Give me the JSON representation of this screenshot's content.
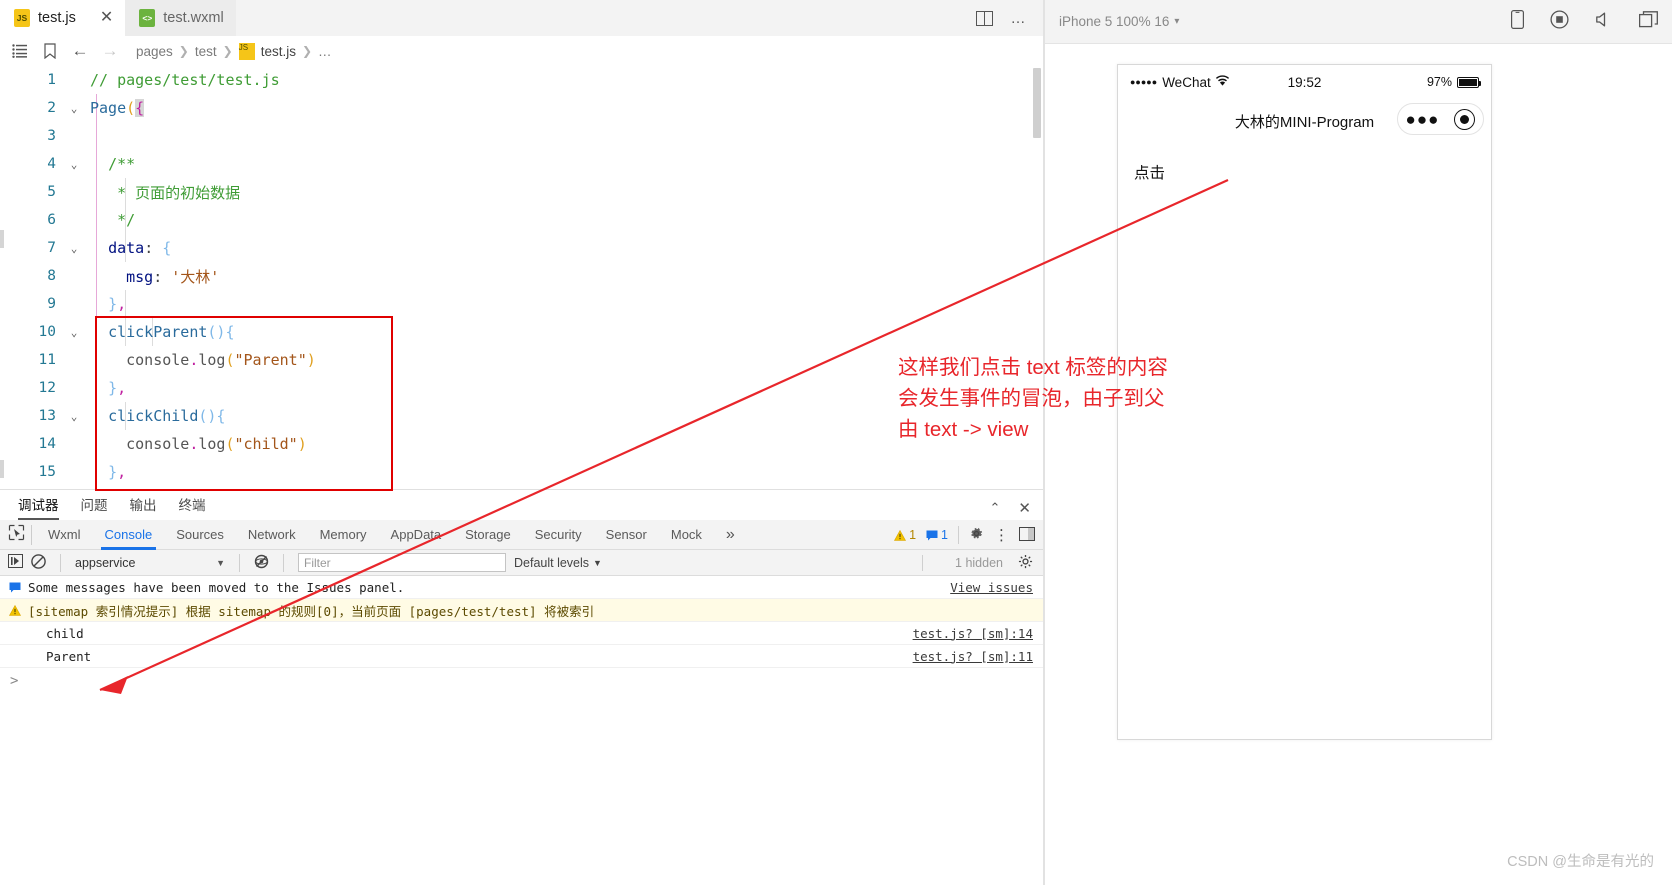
{
  "editor": {
    "tabs": [
      {
        "label": "test.js",
        "icon": "js-file-icon",
        "icon_text": "JS",
        "active": true,
        "closable": true
      },
      {
        "label": "test.wxml",
        "icon": "wxml-file-icon",
        "icon_text": "<>",
        "active": false,
        "closable": false
      }
    ],
    "tabbar_actions": [
      {
        "name": "split-editor-icon",
        "glyph": "▯▯"
      },
      {
        "name": "more-actions-icon",
        "glyph": "…"
      }
    ],
    "breadcrumb": {
      "icons": [
        {
          "name": "outline-icon",
          "glyph": "☰"
        },
        {
          "name": "bookmark-icon",
          "glyph": "🔖"
        },
        {
          "name": "back-arrow-icon",
          "glyph": "←"
        },
        {
          "name": "forward-arrow-icon",
          "glyph": "→"
        }
      ],
      "parts": [
        "pages",
        "test",
        "test.js",
        "…"
      ]
    },
    "lines": [
      {
        "num": "1",
        "fold": "",
        "html": "<span class='cmt'>// pages/test/test.js</span>"
      },
      {
        "num": "2",
        "fold": "⌄",
        "html": "<span class='fn'>Page</span><span class='paren'>(</span><span class='brace-p selbrace'>{</span>"
      },
      {
        "num": "3",
        "fold": "",
        "html": ""
      },
      {
        "num": "4",
        "fold": "⌄",
        "html": "  <span class='cmt'>/**</span>"
      },
      {
        "num": "5",
        "fold": "",
        "html": "   <span class='cmt'>* 页面的初始数据</span>"
      },
      {
        "num": "6",
        "fold": "",
        "html": "   <span class='cmt'>*/</span>"
      },
      {
        "num": "7",
        "fold": "⌄",
        "html": "  <span class='prop'>data</span><span class='punct'>:</span> <span class='brace-b'>{</span>"
      },
      {
        "num": "8",
        "fold": "",
        "html": "    <span class='prop'>msg</span><span class='punct'>:</span> <span class='str'>'大林'</span>"
      },
      {
        "num": "9",
        "fold": "",
        "html": "  <span class='brace-b'>}</span><span class='brace-p'>,</span>"
      },
      {
        "num": "10",
        "fold": "⌄",
        "html": "  <span class='fn'>clickParent</span><span class='brace-b'>(){</span>"
      },
      {
        "num": "11",
        "fold": "",
        "html": "    <span class='obj'>console</span><span class='dot'>.</span><span class='obj'>log</span><span class='paren'>(</span><span class='str'>\"Parent\"</span><span class='paren'>)</span>"
      },
      {
        "num": "12",
        "fold": "",
        "html": "  <span class='brace-b'>}</span><span class='brace-p'>,</span>"
      },
      {
        "num": "13",
        "fold": "⌄",
        "html": "  <span class='fn'>clickChild</span><span class='brace-b'>(){</span>"
      },
      {
        "num": "14",
        "fold": "",
        "html": "    <span class='obj'>console</span><span class='dot'>.</span><span class='obj'>log</span><span class='paren'>(</span><span class='str'>\"child\"</span><span class='paren'>)</span>"
      },
      {
        "num": "15",
        "fold": "",
        "html": "  <span class='brace-b'>}</span><span class='brace-p'>,</span>"
      }
    ]
  },
  "devtools": {
    "panel_tabs": [
      {
        "label": "调试器",
        "active": true
      },
      {
        "label": "问题",
        "active": false
      },
      {
        "label": "输出",
        "active": false
      },
      {
        "label": "终端",
        "active": false
      }
    ],
    "panel_actions": [
      {
        "name": "collapse-panel-icon",
        "glyph": "⌃"
      },
      {
        "name": "close-panel-icon",
        "glyph": "✕"
      }
    ],
    "inspect_icon": "inspect-element-icon",
    "tabs": [
      {
        "label": "Wxml",
        "active": false
      },
      {
        "label": "Console",
        "active": true
      },
      {
        "label": "Sources",
        "active": false
      },
      {
        "label": "Network",
        "active": false
      },
      {
        "label": "Memory",
        "active": false
      },
      {
        "label": "AppData",
        "active": false
      },
      {
        "label": "Storage",
        "active": false
      },
      {
        "label": "Security",
        "active": false
      },
      {
        "label": "Sensor",
        "active": false
      },
      {
        "label": "Mock",
        "active": false
      }
    ],
    "overflow_glyph": "»",
    "warning_count": "1",
    "message_count": "1",
    "settings_icon": "gear-icon",
    "more_icon": "vertical-dots-icon",
    "dock_icon": "dock-panel-icon",
    "filterbar": {
      "execute_icon": "execute-step-icon",
      "clear_icon": "clear-console-icon",
      "context": "appservice",
      "context_caret": "▼",
      "eye_icon": "hide-network-icon",
      "filter_value": "",
      "filter_placeholder": "Filter",
      "levels_label": "Default levels",
      "levels_caret": "▼",
      "hidden_label": "1 hidden",
      "settings_icon": "console-settings-icon"
    },
    "messages": [
      {
        "type": "info",
        "icon": "message-icon",
        "text": "Some messages have been moved to the Issues panel.",
        "link": "View issues"
      },
      {
        "type": "warn",
        "icon": "warning-icon",
        "text": "[sitemap 索引情况提示] 根据 sitemap 的规则[0]，当前页面 [pages/test/test] 将被索引",
        "link": ""
      },
      {
        "type": "log",
        "icon": "",
        "text": "child",
        "link": "test.js? [sm]:14"
      },
      {
        "type": "log",
        "icon": "",
        "text": "Parent",
        "link": "test.js? [sm]:11"
      }
    ],
    "prompt_glyph": ">"
  },
  "simulator": {
    "toolbar": {
      "device": "iPhone 5 100% 16",
      "caret": "▾",
      "actions": [
        {
          "name": "device-frame-icon",
          "glyph": "▯"
        },
        {
          "name": "record-icon",
          "glyph": "◉"
        },
        {
          "name": "volume-icon",
          "glyph": "◁"
        },
        {
          "name": "multi-window-icon",
          "glyph": "❐"
        }
      ]
    },
    "status_bar": {
      "signal_dots": "●●●●●",
      "carrier": "WeChat",
      "wifi_icon": "wifi-icon",
      "time": "19:52",
      "battery_percent": "97%"
    },
    "nav": {
      "title": "大林的MINI-Program",
      "capsule": {
        "menu_dots": "●●●",
        "target_icon": "capsule-target-icon"
      }
    },
    "page": {
      "text": "点击"
    }
  },
  "annotations": {
    "note_lines": [
      "这样我们点击 text 标签的内容",
      "会发生事件的冒泡，由子到父",
      "由 text -> view"
    ],
    "arrow_color": "#e8262b",
    "box_color": "#e00000"
  },
  "watermark": "CSDN @生命是有光的"
}
